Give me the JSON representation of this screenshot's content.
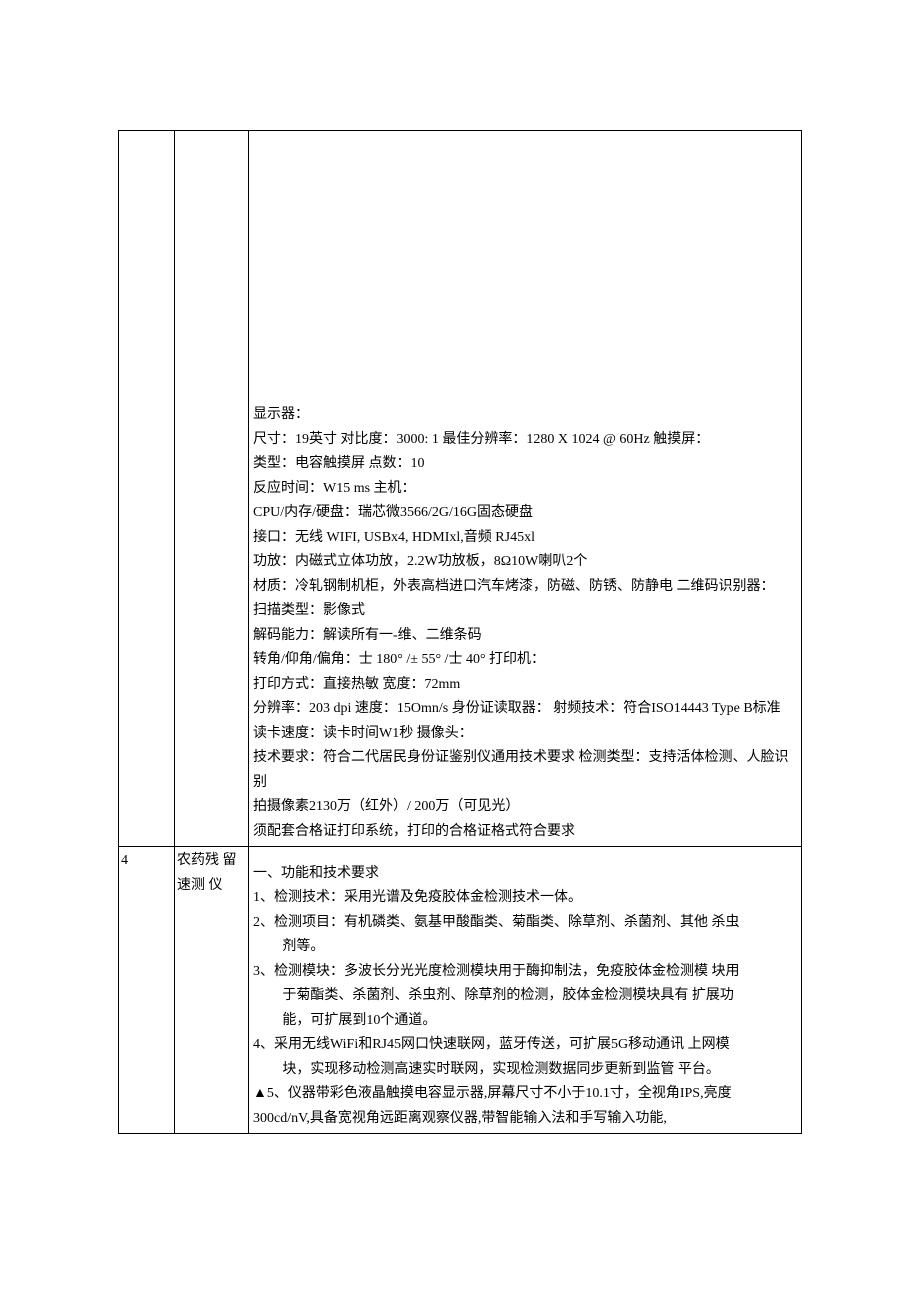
{
  "row1": {
    "no": "",
    "name": "",
    "specs": {
      "display_header": "显示器：",
      "display_line": "尺寸：19英寸  对比度：3000: 1 最佳分辨率：1280 X 1024 @ 60Hz 触摸屏：",
      "touch_type": "类型：电容触摸屏  点数：10",
      "reaction": "反应时间：W15 ms 主机：",
      "cpu": "CPU/内存/硬盘：瑞芯微3566/2G/16G固态硬盘",
      "ports": "接口：无线  WIFI, USBx4, HDMIxl,音频  RJ45xl",
      "amp": "功放：内磁式立体功放，2.2W功放板，8Ω10W喇叭2个",
      "material": "材质：冷轧钢制机柜，外表高档进口汽车烤漆，防磁、防锈、防静电  二维码识别器：",
      "scan_type": "扫描类型：影像式",
      "decode": "解码能力：解读所有一-维、二维条码",
      "angles": "转角/仰角/偏角：士  180° /± 55° /士  40° 打印机：",
      "print_mode": "打印方式：直接热敏  宽度：72mm",
      "resolution": "分辨率：203 dpi 速度：15Omn/s 身份证读取器：    射频技术：符合ISO14443 Type B标准  读卡速度：读卡时间W1秒  摄像头：",
      "tech_req": "技术要求：符合二代居民身份证鉴别仪通用技术要求  检测类型：支持活体检测、人脸识别",
      "pixels": "拍摄像素2130万（红外）/ 200万（可见光）",
      "certificate": "须配套合格证打印系统，打印的合格证格式符合要求"
    }
  },
  "row2": {
    "no": "4",
    "name": "农药残  留速测  仪",
    "section_title": "一、功能和技术要求",
    "items": {
      "i1": "1、检测技术：采用光谱及免疫胶体金检测技术一体。",
      "i2a": "2、检测项目：有机磷类、氨基甲酸酯类、菊酯类、除草剂、杀菌剂、其他  杀虫",
      "i2b": "剂等。",
      "i3a": "3、检测模块：多波长分光光度检测模块用于酶抑制法，免疫胶体金检测模  块用",
      "i3b": "于菊酯类、杀菌剂、杀虫剂、除草剂的检测，胶体金检测模块具有  扩展功",
      "i3c": "能，可扩展到10个通道。",
      "i4a": "4、采用无线WiFi和RJ45网口快速联网，蓝牙传送，可扩展5G移动通讯  上网模",
      "i4b": "块，实现移动检测高速实时联网，实现检测数据同步更新到监管  平台。",
      "i5a": "▲5、仪器带彩色液晶触摸电容显示器,屏幕尺寸不小于10.1寸，全视角IPS,亮度",
      "i5b": "300cd/nV,具备宽视角远距离观察仪器,带智能输入法和手写输入功能,"
    }
  }
}
